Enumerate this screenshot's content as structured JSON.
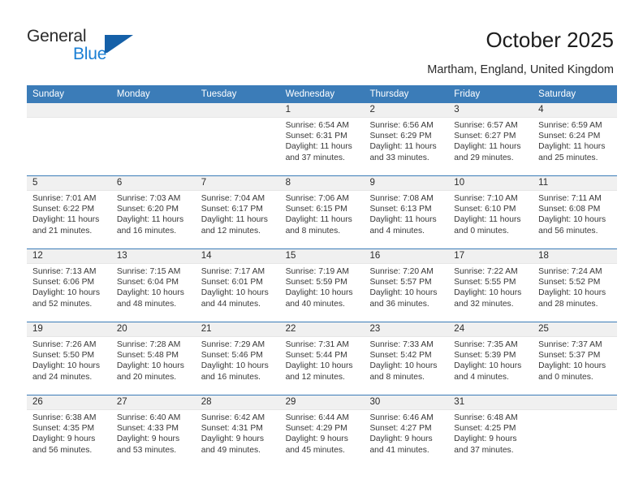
{
  "brand": {
    "name_part1": "General",
    "name_part2": "Blue",
    "accent_color": "#1560a8",
    "logo_icon": "triangle-flag-icon"
  },
  "header": {
    "title": "October 2025",
    "location": "Martham, England, United Kingdom"
  },
  "calendar": {
    "header_bg": "#3b7cb8",
    "daynum_bg": "#f0f0f0",
    "weekday_names": [
      "Sunday",
      "Monday",
      "Tuesday",
      "Wednesday",
      "Thursday",
      "Friday",
      "Saturday"
    ],
    "weeks": [
      [
        {
          "day": "",
          "empty": true
        },
        {
          "day": "",
          "empty": true
        },
        {
          "day": "",
          "empty": true
        },
        {
          "day": "1",
          "sunrise": "Sunrise: 6:54 AM",
          "sunset": "Sunset: 6:31 PM",
          "daylight1": "Daylight: 11 hours",
          "daylight2": "and 37 minutes."
        },
        {
          "day": "2",
          "sunrise": "Sunrise: 6:56 AM",
          "sunset": "Sunset: 6:29 PM",
          "daylight1": "Daylight: 11 hours",
          "daylight2": "and 33 minutes."
        },
        {
          "day": "3",
          "sunrise": "Sunrise: 6:57 AM",
          "sunset": "Sunset: 6:27 PM",
          "daylight1": "Daylight: 11 hours",
          "daylight2": "and 29 minutes."
        },
        {
          "day": "4",
          "sunrise": "Sunrise: 6:59 AM",
          "sunset": "Sunset: 6:24 PM",
          "daylight1": "Daylight: 11 hours",
          "daylight2": "and 25 minutes."
        }
      ],
      [
        {
          "day": "5",
          "sunrise": "Sunrise: 7:01 AM",
          "sunset": "Sunset: 6:22 PM",
          "daylight1": "Daylight: 11 hours",
          "daylight2": "and 21 minutes."
        },
        {
          "day": "6",
          "sunrise": "Sunrise: 7:03 AM",
          "sunset": "Sunset: 6:20 PM",
          "daylight1": "Daylight: 11 hours",
          "daylight2": "and 16 minutes."
        },
        {
          "day": "7",
          "sunrise": "Sunrise: 7:04 AM",
          "sunset": "Sunset: 6:17 PM",
          "daylight1": "Daylight: 11 hours",
          "daylight2": "and 12 minutes."
        },
        {
          "day": "8",
          "sunrise": "Sunrise: 7:06 AM",
          "sunset": "Sunset: 6:15 PM",
          "daylight1": "Daylight: 11 hours",
          "daylight2": "and 8 minutes."
        },
        {
          "day": "9",
          "sunrise": "Sunrise: 7:08 AM",
          "sunset": "Sunset: 6:13 PM",
          "daylight1": "Daylight: 11 hours",
          "daylight2": "and 4 minutes."
        },
        {
          "day": "10",
          "sunrise": "Sunrise: 7:10 AM",
          "sunset": "Sunset: 6:10 PM",
          "daylight1": "Daylight: 11 hours",
          "daylight2": "and 0 minutes."
        },
        {
          "day": "11",
          "sunrise": "Sunrise: 7:11 AM",
          "sunset": "Sunset: 6:08 PM",
          "daylight1": "Daylight: 10 hours",
          "daylight2": "and 56 minutes."
        }
      ],
      [
        {
          "day": "12",
          "sunrise": "Sunrise: 7:13 AM",
          "sunset": "Sunset: 6:06 PM",
          "daylight1": "Daylight: 10 hours",
          "daylight2": "and 52 minutes."
        },
        {
          "day": "13",
          "sunrise": "Sunrise: 7:15 AM",
          "sunset": "Sunset: 6:04 PM",
          "daylight1": "Daylight: 10 hours",
          "daylight2": "and 48 minutes."
        },
        {
          "day": "14",
          "sunrise": "Sunrise: 7:17 AM",
          "sunset": "Sunset: 6:01 PM",
          "daylight1": "Daylight: 10 hours",
          "daylight2": "and 44 minutes."
        },
        {
          "day": "15",
          "sunrise": "Sunrise: 7:19 AM",
          "sunset": "Sunset: 5:59 PM",
          "daylight1": "Daylight: 10 hours",
          "daylight2": "and 40 minutes."
        },
        {
          "day": "16",
          "sunrise": "Sunrise: 7:20 AM",
          "sunset": "Sunset: 5:57 PM",
          "daylight1": "Daylight: 10 hours",
          "daylight2": "and 36 minutes."
        },
        {
          "day": "17",
          "sunrise": "Sunrise: 7:22 AM",
          "sunset": "Sunset: 5:55 PM",
          "daylight1": "Daylight: 10 hours",
          "daylight2": "and 32 minutes."
        },
        {
          "day": "18",
          "sunrise": "Sunrise: 7:24 AM",
          "sunset": "Sunset: 5:52 PM",
          "daylight1": "Daylight: 10 hours",
          "daylight2": "and 28 minutes."
        }
      ],
      [
        {
          "day": "19",
          "sunrise": "Sunrise: 7:26 AM",
          "sunset": "Sunset: 5:50 PM",
          "daylight1": "Daylight: 10 hours",
          "daylight2": "and 24 minutes."
        },
        {
          "day": "20",
          "sunrise": "Sunrise: 7:28 AM",
          "sunset": "Sunset: 5:48 PM",
          "daylight1": "Daylight: 10 hours",
          "daylight2": "and 20 minutes."
        },
        {
          "day": "21",
          "sunrise": "Sunrise: 7:29 AM",
          "sunset": "Sunset: 5:46 PM",
          "daylight1": "Daylight: 10 hours",
          "daylight2": "and 16 minutes."
        },
        {
          "day": "22",
          "sunrise": "Sunrise: 7:31 AM",
          "sunset": "Sunset: 5:44 PM",
          "daylight1": "Daylight: 10 hours",
          "daylight2": "and 12 minutes."
        },
        {
          "day": "23",
          "sunrise": "Sunrise: 7:33 AM",
          "sunset": "Sunset: 5:42 PM",
          "daylight1": "Daylight: 10 hours",
          "daylight2": "and 8 minutes."
        },
        {
          "day": "24",
          "sunrise": "Sunrise: 7:35 AM",
          "sunset": "Sunset: 5:39 PM",
          "daylight1": "Daylight: 10 hours",
          "daylight2": "and 4 minutes."
        },
        {
          "day": "25",
          "sunrise": "Sunrise: 7:37 AM",
          "sunset": "Sunset: 5:37 PM",
          "daylight1": "Daylight: 10 hours",
          "daylight2": "and 0 minutes."
        }
      ],
      [
        {
          "day": "26",
          "sunrise": "Sunrise: 6:38 AM",
          "sunset": "Sunset: 4:35 PM",
          "daylight1": "Daylight: 9 hours",
          "daylight2": "and 56 minutes."
        },
        {
          "day": "27",
          "sunrise": "Sunrise: 6:40 AM",
          "sunset": "Sunset: 4:33 PM",
          "daylight1": "Daylight: 9 hours",
          "daylight2": "and 53 minutes."
        },
        {
          "day": "28",
          "sunrise": "Sunrise: 6:42 AM",
          "sunset": "Sunset: 4:31 PM",
          "daylight1": "Daylight: 9 hours",
          "daylight2": "and 49 minutes."
        },
        {
          "day": "29",
          "sunrise": "Sunrise: 6:44 AM",
          "sunset": "Sunset: 4:29 PM",
          "daylight1": "Daylight: 9 hours",
          "daylight2": "and 45 minutes."
        },
        {
          "day": "30",
          "sunrise": "Sunrise: 6:46 AM",
          "sunset": "Sunset: 4:27 PM",
          "daylight1": "Daylight: 9 hours",
          "daylight2": "and 41 minutes."
        },
        {
          "day": "31",
          "sunrise": "Sunrise: 6:48 AM",
          "sunset": "Sunset: 4:25 PM",
          "daylight1": "Daylight: 9 hours",
          "daylight2": "and 37 minutes."
        },
        {
          "day": "",
          "empty": true
        }
      ]
    ]
  }
}
